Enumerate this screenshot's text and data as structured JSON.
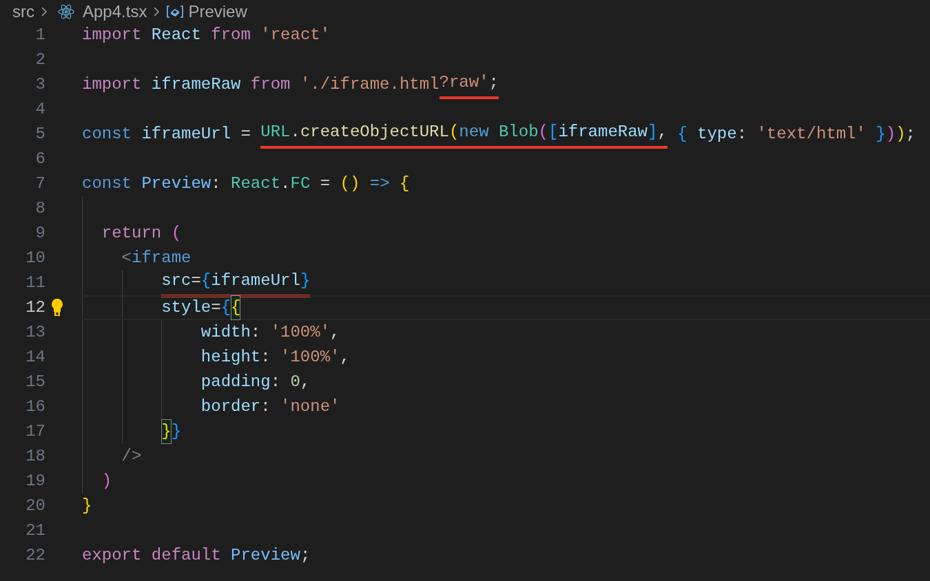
{
  "breadcrumb": [
    {
      "label": "src",
      "kind": "folder"
    },
    {
      "label": "App4.tsx",
      "kind": "react-file"
    },
    {
      "label": "Preview",
      "kind": "symbol"
    }
  ],
  "lines": [
    {
      "number": "1",
      "current": false,
      "tokens": [
        {
          "text": "import",
          "kind": "keyword"
        },
        {
          "text": " React",
          "kind": "variable"
        },
        {
          "text": " from",
          "kind": "keyword"
        },
        {
          "text": " 'react'",
          "kind": "string"
        }
      ]
    },
    {
      "number": "2",
      "current": false
    },
    {
      "number": "3",
      "current": false,
      "tokens": [
        {
          "text": "import",
          "kind": "keyword"
        },
        {
          "text": " iframeRaw",
          "kind": "variable"
        },
        {
          "text": " from",
          "kind": "keyword"
        },
        {
          "text": " './iframe.html",
          "kind": "string"
        },
        {
          "text": "?raw'",
          "kind": "string",
          "underlined": true
        },
        {
          "text": ";",
          "kind": "plain",
          "underlined": true
        }
      ]
    },
    {
      "number": "4",
      "current": false
    },
    {
      "number": "5",
      "current": false,
      "tokens": [
        {
          "text": "const",
          "kind": "storage"
        },
        {
          "text": " iframeUrl",
          "kind": "variable"
        },
        {
          "text": " =",
          "kind": "plain"
        },
        {
          "text": " URL",
          "kind": "type",
          "underlined": true
        },
        {
          "text": ".",
          "kind": "plain",
          "underlined": true
        },
        {
          "text": "createObjectURL",
          "kind": "function",
          "underlined": true
        },
        {
          "text": "(",
          "kind": "bracket1",
          "underlined": true
        },
        {
          "text": "new",
          "kind": "storage",
          "underlined": true
        },
        {
          "text": " Blob",
          "kind": "type",
          "underlined": true
        },
        {
          "text": "(",
          "kind": "bracket2",
          "underlined": true
        },
        {
          "text": "[",
          "kind": "bracket3",
          "underlined": true
        },
        {
          "text": "iframeRaw",
          "kind": "variable",
          "underlined": true
        },
        {
          "text": "]",
          "kind": "bracket3",
          "underlined": true
        },
        {
          "text": ",",
          "kind": "plain",
          "underlined": true
        },
        {
          "text": " {",
          "kind": "bracket3"
        },
        {
          "text": " type",
          "kind": "variable"
        },
        {
          "text": ":",
          "kind": "plain"
        },
        {
          "text": " 'text/html'",
          "kind": "string"
        },
        {
          "text": " }",
          "kind": "bracket3"
        },
        {
          "text": ")",
          "kind": "bracket2"
        },
        {
          "text": ")",
          "kind": "bracket1"
        },
        {
          "text": ";",
          "kind": "plain"
        }
      ]
    },
    {
      "number": "6",
      "current": false
    },
    {
      "number": "7",
      "current": false,
      "tokens": [
        {
          "text": "const",
          "kind": "storage"
        },
        {
          "text": " Preview",
          "kind": "constant"
        },
        {
          "text": ":",
          "kind": "plain"
        },
        {
          "text": " React",
          "kind": "type"
        },
        {
          "text": ".",
          "kind": "plain"
        },
        {
          "text": "FC",
          "kind": "type"
        },
        {
          "text": " =",
          "kind": "plain"
        },
        {
          "text": " ()",
          "kind": "bracket1"
        },
        {
          "text": " =>",
          "kind": "storage"
        },
        {
          "text": " {",
          "kind": "bracket1"
        }
      ]
    },
    {
      "number": "8",
      "current": false
    },
    {
      "number": "9",
      "current": false,
      "tokens": [
        {
          "text": "  return",
          "kind": "keyword"
        },
        {
          "text": " (",
          "kind": "bracket2"
        }
      ]
    },
    {
      "number": "10",
      "current": false,
      "tokens": [
        {
          "text": "    <",
          "kind": "punct"
        },
        {
          "text": "iframe",
          "kind": "storage"
        }
      ]
    },
    {
      "number": "11",
      "current": false,
      "tokens": [
        {
          "text": "        src",
          "kind": "variable",
          "underlined": true
        },
        {
          "text": "=",
          "kind": "plain",
          "underlined": true
        },
        {
          "text": "{",
          "kind": "bracket3",
          "underlined": true
        },
        {
          "text": "iframeUrl",
          "kind": "variable",
          "underlined": true
        },
        {
          "text": "}",
          "kind": "bracket3",
          "underlined": true
        }
      ]
    },
    {
      "number": "12",
      "current": true,
      "tokens": [
        {
          "text": "        style",
          "kind": "variable"
        },
        {
          "text": "=",
          "kind": "plain"
        },
        {
          "text": "{",
          "kind": "bracket3"
        },
        {
          "text": "{",
          "kind": "bracket1",
          "matched": true
        }
      ]
    },
    {
      "number": "13",
      "current": false,
      "tokens": [
        {
          "text": "            width",
          "kind": "variable"
        },
        {
          "text": ":",
          "kind": "plain"
        },
        {
          "text": " '100%'",
          "kind": "string"
        },
        {
          "text": ",",
          "kind": "plain"
        }
      ]
    },
    {
      "number": "14",
      "current": false,
      "tokens": [
        {
          "text": "            height",
          "kind": "variable"
        },
        {
          "text": ":",
          "kind": "plain"
        },
        {
          "text": " '100%'",
          "kind": "string"
        },
        {
          "text": ",",
          "kind": "plain"
        }
      ]
    },
    {
      "number": "15",
      "current": false,
      "tokens": [
        {
          "text": "            padding",
          "kind": "variable"
        },
        {
          "text": ":",
          "kind": "plain"
        },
        {
          "text": " 0",
          "kind": "number"
        },
        {
          "text": ",",
          "kind": "plain"
        }
      ]
    },
    {
      "number": "16",
      "current": false,
      "tokens": [
        {
          "text": "            border",
          "kind": "variable"
        },
        {
          "text": ":",
          "kind": "plain"
        },
        {
          "text": " 'none'",
          "kind": "string"
        }
      ]
    },
    {
      "number": "17",
      "current": false,
      "tokens": [
        {
          "text": "        }",
          "kind": "bracket1",
          "matched": true
        },
        {
          "text": "}",
          "kind": "bracket3"
        }
      ]
    },
    {
      "number": "18",
      "current": false,
      "tokens": [
        {
          "text": "    />",
          "kind": "punct"
        }
      ]
    },
    {
      "number": "19",
      "current": false,
      "tokens": [
        {
          "text": "  )",
          "kind": "bracket2"
        }
      ]
    },
    {
      "number": "20",
      "current": false,
      "tokens": [
        {
          "text": "}",
          "kind": "bracket1"
        }
      ]
    },
    {
      "number": "21",
      "current": false
    },
    {
      "number": "22",
      "current": false,
      "tokens": [
        {
          "text": "export",
          "kind": "keyword"
        },
        {
          "text": " default",
          "kind": "keyword"
        },
        {
          "text": " Preview",
          "kind": "constant"
        },
        {
          "text": ";",
          "kind": "plain"
        }
      ]
    }
  ]
}
